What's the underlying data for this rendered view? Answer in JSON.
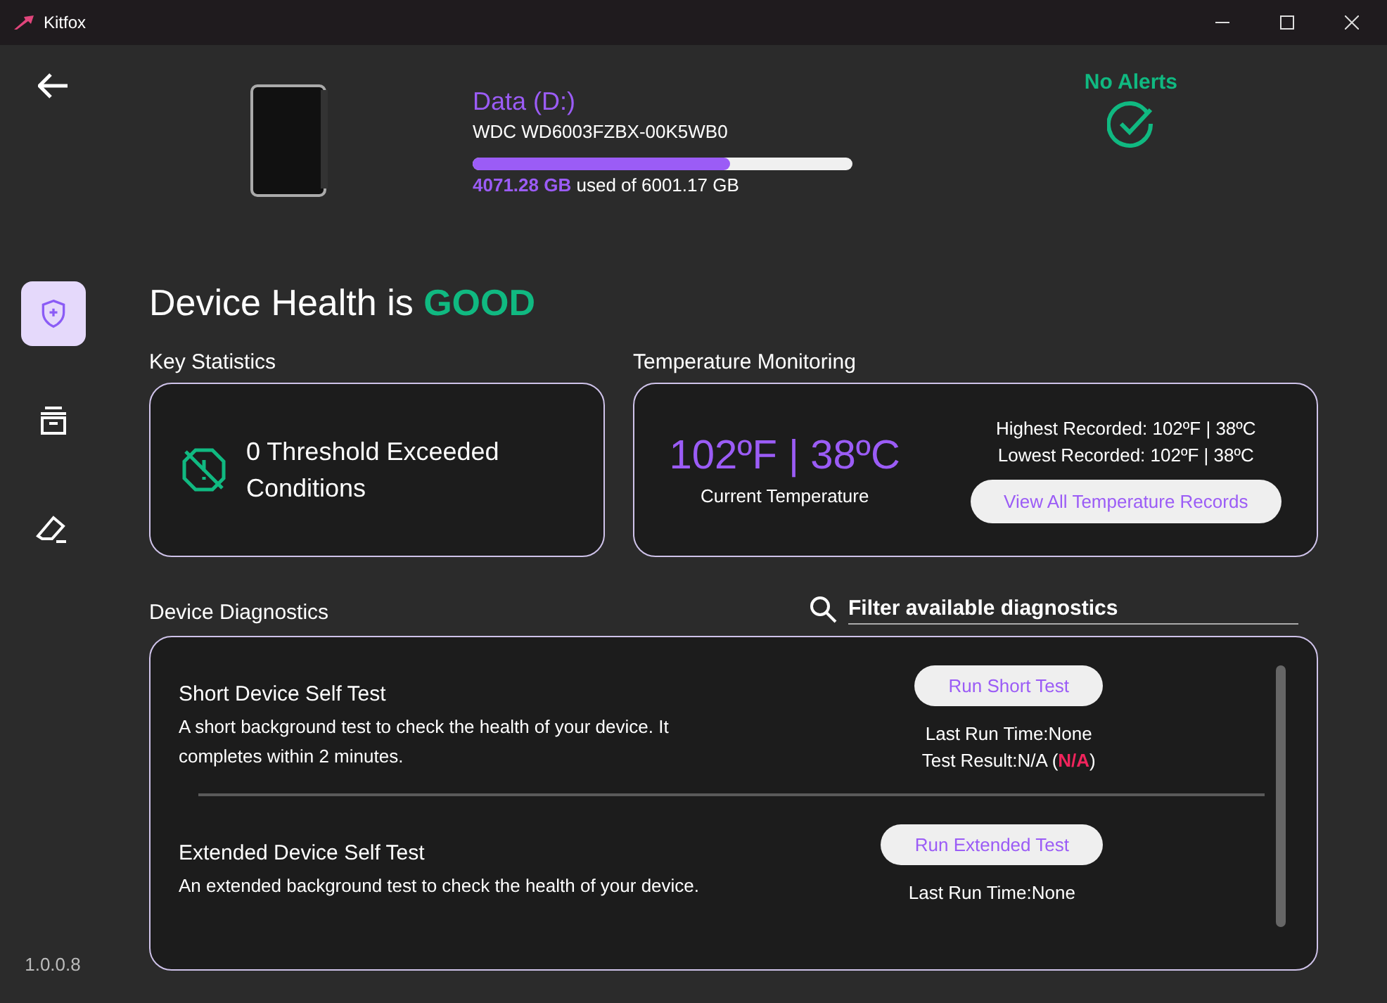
{
  "window": {
    "title": "Kitfox"
  },
  "sidebar": {
    "items": [
      {
        "kind": "health",
        "selected": true
      },
      {
        "kind": "archive",
        "selected": false
      },
      {
        "kind": "eraser",
        "selected": false
      }
    ],
    "version": "1.0.0.8"
  },
  "drive": {
    "name": "Data (D:)",
    "model": "WDC WD6003FZBX-00K5WB0",
    "level": 0.678,
    "used": "4071.28 GB",
    "usage_text": "used of 6001.17 GB"
  },
  "alerts": {
    "label": "No Alerts"
  },
  "health": {
    "prefix": "Device Health is",
    "status": "GOOD"
  },
  "key_statistics": {
    "heading": "Key Statistics",
    "text": "0 Threshold Exceeded Conditions"
  },
  "temperature": {
    "heading": "Temperature Monitoring",
    "current": "102ºF | 38ºC",
    "current_label": "Current Temperature",
    "highest": "Highest Recorded: 102ºF | 38ºC",
    "lowest": "Lowest Recorded: 102ºF | 38ºC",
    "button": "View All Temperature Records"
  },
  "diagnostics": {
    "heading": "Device Diagnostics",
    "filter_placeholder": "Filter available diagnostics",
    "tests": [
      {
        "title": "Short Device Self Test",
        "description": "A short background test to check the health of your device. It completes within 2 minutes.",
        "button": "Run Short Test",
        "last_run": "Last Run Time:None",
        "result": "Test Result:N/A (**N/A**)"
      },
      {
        "title": "Extended Device Self Test",
        "description": "An extended background test to check the health of your device.",
        "button": "Run Extended Test",
        "last_run": "Last Run Time:None"
      }
    ]
  }
}
